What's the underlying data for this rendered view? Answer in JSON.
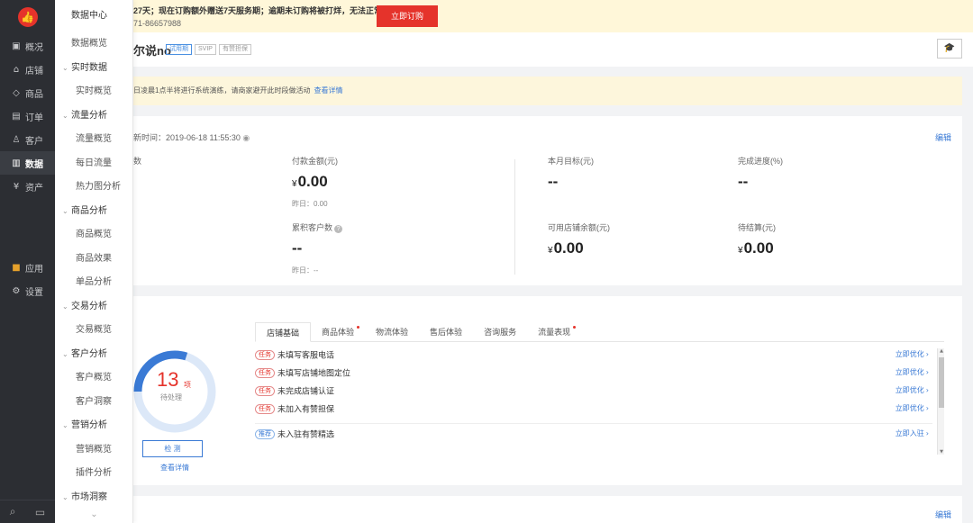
{
  "nav": {
    "items": [
      {
        "icon": "chat-icon",
        "glyph": "▣",
        "label": "概况",
        "active": true
      },
      {
        "icon": "store-icon",
        "glyph": "⌂",
        "label": "店铺"
      },
      {
        "icon": "tag-icon",
        "glyph": "◇",
        "label": "商品"
      },
      {
        "icon": "order-icon",
        "glyph": "▤",
        "label": "订单"
      },
      {
        "icon": "user-icon",
        "glyph": "♙",
        "label": "客户"
      },
      {
        "icon": "bar-chart-icon",
        "glyph": "▥",
        "label": "数据",
        "active": true
      },
      {
        "icon": "money-icon",
        "glyph": "¥",
        "label": "资产"
      },
      {
        "icon": "apps-icon",
        "glyph": "■",
        "label": "应用"
      },
      {
        "icon": "gear-icon",
        "glyph": "⚙",
        "label": "设置"
      }
    ]
  },
  "submenu": {
    "title": "数据中心",
    "overview": "数据概览",
    "groups": [
      {
        "label": "实时数据",
        "items": [
          "实时概览"
        ]
      },
      {
        "label": "流量分析",
        "items": [
          "流量概览",
          "每日流量",
          "热力图分析"
        ]
      },
      {
        "label": "商品分析",
        "items": [
          "商品概览",
          "商品效果",
          "单品分析"
        ]
      },
      {
        "label": "交易分析",
        "items": [
          "交易概览"
        ]
      },
      {
        "label": "客户分析",
        "items": [
          "客户概览",
          "客户洞察"
        ]
      },
      {
        "label": "营销分析",
        "items": [
          "营销概览",
          "插件分析"
        ]
      },
      {
        "label": "市场洞察",
        "items": []
      }
    ]
  },
  "banner": {
    "line1": "27天；现在订购额外赠送7天服务期；逾期未订购将被打烊，无法正常营业",
    "line2": "71-86657988",
    "button": "立即订购"
  },
  "shop": {
    "name": "尔说no",
    "tags": [
      "试用期",
      "SVIP",
      "有赞担保"
    ]
  },
  "notice": {
    "text": "日凌晨1点半将进行系统演练，请商家避开此时段做活动",
    "link": "查看详情"
  },
  "overview": {
    "updated": "新时间：2019-06-18 11:55:30",
    "edit": "编辑",
    "metrics": [
      {
        "label": "数",
        "value": "",
        "sub": ""
      },
      {
        "label": "付款金额(元)",
        "value": "0.00",
        "currency": "¥",
        "sub": "昨日：0.00"
      },
      {
        "label": "本月目标(元)",
        "value": "--",
        "sub": ""
      },
      {
        "label": "完成进度(%)",
        "value": "--",
        "sub": ""
      },
      {
        "label": "累积客户数",
        "value": "--",
        "sub": "昨日：--"
      },
      {
        "label": "可用店铺余额(元)",
        "value": "0.00",
        "currency": "¥",
        "sub": ""
      },
      {
        "label": "待结算(元)",
        "value": "0.00",
        "currency": "¥",
        "sub": ""
      }
    ]
  },
  "health": {
    "pending_count": "13",
    "pending_unit": "项",
    "pending_label": "待处理",
    "progress_fraction": 0.3,
    "check_button": "检 测",
    "view_details": "查看详情",
    "tabs": [
      {
        "label": "店铺基础",
        "active": true,
        "dot": false
      },
      {
        "label": "商品体验",
        "dot": true
      },
      {
        "label": "物流体验",
        "dot": false
      },
      {
        "label": "售后体验",
        "dot": false
      },
      {
        "label": "咨询服务",
        "dot": false
      },
      {
        "label": "流量表现",
        "dot": true
      }
    ],
    "tasks": [
      {
        "badge": "任务",
        "text": "未填写客服电话",
        "action": "立即优化"
      },
      {
        "badge": "任务",
        "text": "未填写店铺地图定位",
        "action": "立即优化"
      },
      {
        "badge": "任务",
        "text": "未完成店铺认证",
        "action": "立即优化"
      },
      {
        "badge": "任务",
        "text": "未加入有赞担保",
        "action": "立即优化"
      },
      {
        "badge": "推荐",
        "text": "未入驻有赞精选",
        "action": "立即入驻"
      }
    ]
  },
  "bottom_card": {
    "edit": "编辑"
  },
  "colors": {
    "accent": "#e5332b",
    "link": "#3a7ad5",
    "nav_bg": "#2c2e33"
  }
}
